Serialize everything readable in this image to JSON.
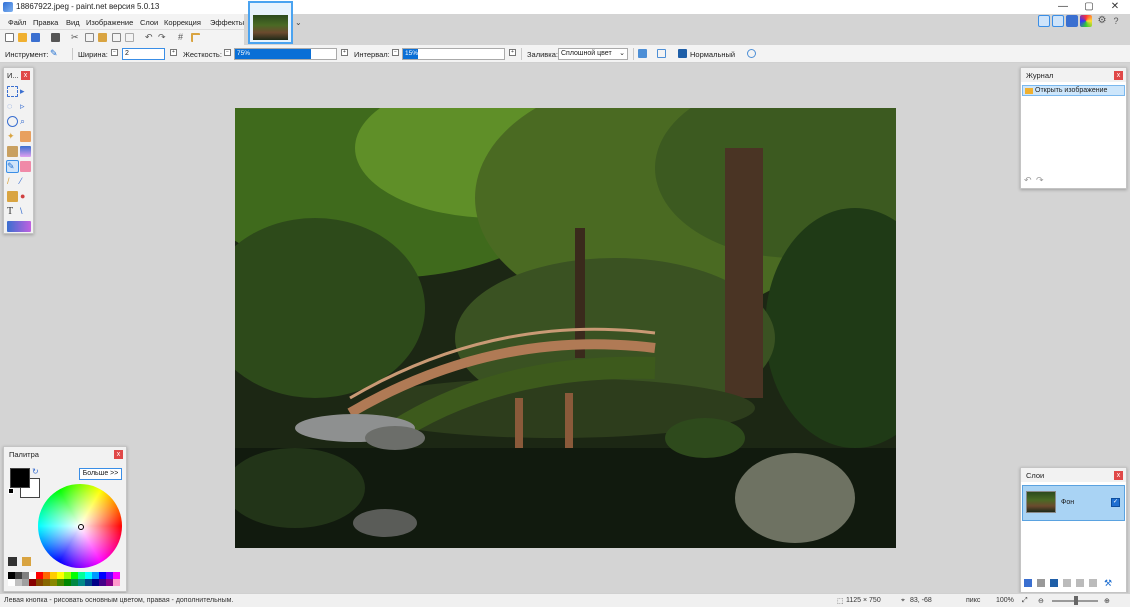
{
  "window": {
    "title": "18867922.jpeg - paint.net версия 5.0.13",
    "minimize": "—",
    "maximize": "▢",
    "close": "✕"
  },
  "menu": [
    "Файл",
    "Правка",
    "Вид",
    "Изображение",
    "Слои",
    "Коррекция",
    "Эффекты"
  ],
  "toolbar": {
    "tool_label": "Инструмент:",
    "width_label": "Ширина:",
    "width_value": "2",
    "hardness_label": "Жесткость:",
    "hardness_value": "75%",
    "hardness_fraction": 0.75,
    "interval_label": "Интервал:",
    "interval_value": "15%",
    "interval_fraction": 0.15,
    "fill_label": "Заливка:",
    "fill_value": "Сплошной цвет",
    "blend_mode": "Нормальный"
  },
  "panels": {
    "tools": {
      "title": "И..."
    },
    "history": {
      "title": "Журнал",
      "items": [
        "Открыть изображение"
      ]
    },
    "layers": {
      "title": "Слои",
      "items": [
        {
          "name": "Фон",
          "visible": true
        }
      ]
    },
    "palette": {
      "title": "Палитра",
      "more_button": "Больше >>"
    }
  },
  "status": {
    "hint": "Левая кнопка - рисовать основным цветом, правая - дополнительным.",
    "image_size": "1125 × 750",
    "cursor_pos": "83, -68",
    "units": "пикс",
    "zoom": "100%"
  },
  "colors": {
    "accent": "#3a8ee6",
    "primary_color": "#000000",
    "secondary_color": "#ffffff",
    "close_button": "#e04848"
  },
  "icons": [
    "save-icon",
    "open-icon",
    "new-icon",
    "print-icon",
    "cut-icon",
    "copy-icon",
    "paste-icon",
    "undo-icon",
    "redo-icon",
    "grid-icon",
    "ruler-icon",
    "settings-icon",
    "help-icon"
  ]
}
